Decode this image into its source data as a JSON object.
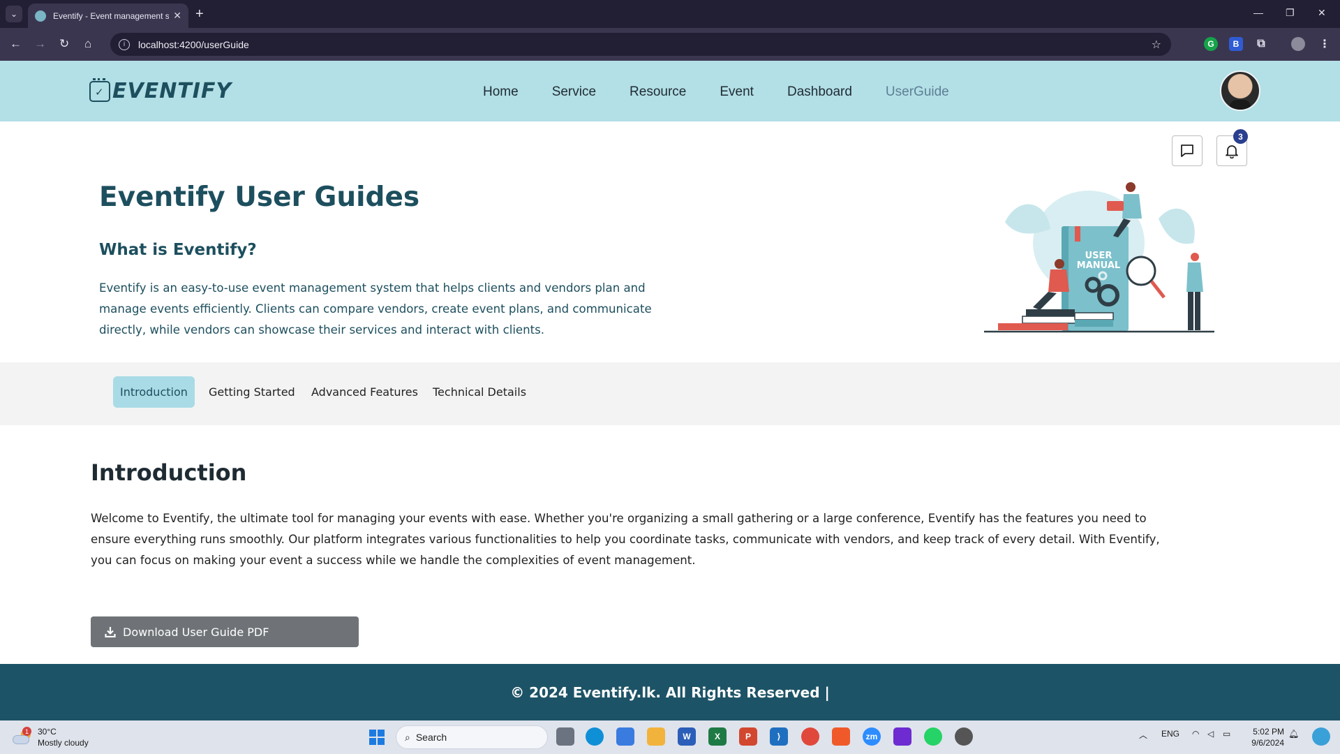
{
  "browser": {
    "tab_title": "Eventify - Event management s",
    "url": "localhost:4200/userGuide",
    "new_tab": "+",
    "tab_close": "✕"
  },
  "site": {
    "logo_text": "EVENTIFY",
    "nav": [
      {
        "label": "Home"
      },
      {
        "label": "Service"
      },
      {
        "label": "Resource"
      },
      {
        "label": "Event"
      },
      {
        "label": "Dashboard"
      },
      {
        "label": "UserGuide",
        "active": true
      }
    ],
    "notification_count": "3"
  },
  "hero": {
    "title": "Eventify User Guides",
    "subtitle": "What is Eventify?",
    "description": "Eventify is an easy-to-use event management system that helps clients and vendors plan and manage events efficiently. Clients can compare vendors, create event plans, and communicate directly, while vendors can showcase their services and interact with clients.",
    "illustration_text_line1": "USER",
    "illustration_text_line2": "MANUAL"
  },
  "guide_tabs": [
    {
      "label": "Introduction",
      "active": true
    },
    {
      "label": "Getting Started"
    },
    {
      "label": "Advanced Features"
    },
    {
      "label": "Technical Details"
    }
  ],
  "section": {
    "title": "Introduction",
    "body": "Welcome to Eventify, the ultimate tool for managing your events with ease. Whether you're organizing a small gathering or a large conference, Eventify has the features you need to ensure everything runs smoothly. Our platform integrates various functionalities to help you coordinate tasks, communicate with vendors, and keep track of every detail. With Eventify, you can focus on making your event a success while we handle the complexities of event management.",
    "download_label": "Download User Guide PDF"
  },
  "footer": {
    "text": "© 2024 Eventify.lk. All Rights Reserved |"
  },
  "taskbar": {
    "weather_temp": "30°C",
    "weather_desc": "Mostly cloudy",
    "weather_badge": "1",
    "search_label": "Search",
    "lang": "ENG",
    "time": "5:02 PM",
    "date": "9/6/2024"
  },
  "colors": {
    "header_bg": "#b3dfe6",
    "brand_dark": "#1d4f5e",
    "footer_bg": "#1d5366",
    "active_tab_bg": "#a9dbe6",
    "download_btn_bg": "#6f7377"
  }
}
